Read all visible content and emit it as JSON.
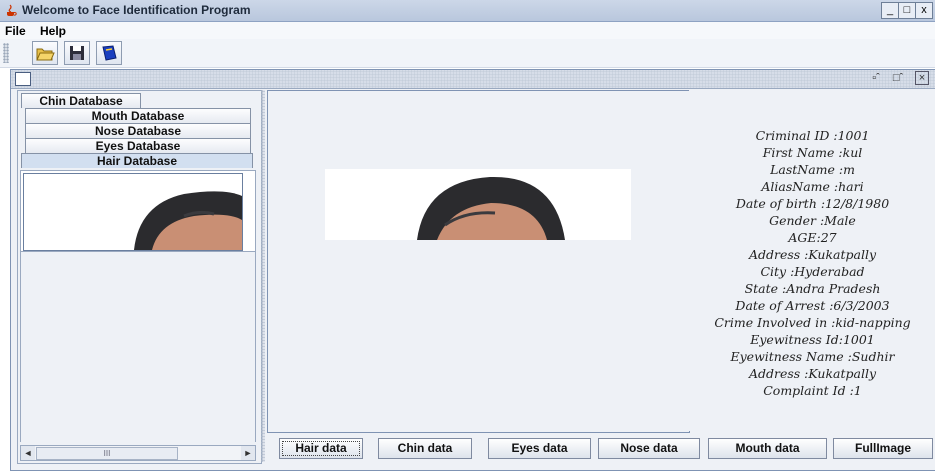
{
  "window": {
    "title": "Welcome to Face Identification Program",
    "minimize": "_",
    "maximize": "□",
    "close": "x"
  },
  "menu": {
    "items": [
      "File",
      "Help"
    ]
  },
  "toolbar": {
    "buttons": [
      "open-folder-icon",
      "save-icon",
      "book-icon"
    ]
  },
  "tabs": [
    "Chin Database",
    "Mouth Database",
    "Nose Database",
    "Eyes Database",
    "Hair Database"
  ],
  "active_tab": "Hair Database",
  "scrollbar": {
    "left": "◄",
    "right": "►",
    "grip": "III"
  },
  "details": [
    "Criminal ID :1001",
    "First Name :kul",
    "LastName :m",
    "AliasName :hari",
    "Date of birth :12/8/1980",
    "Gender :Male",
    "AGE:27",
    "Address :Kukatpally",
    "City :Hyderabad",
    "State :Andra Pradesh",
    "Date of Arrest :6/3/2003",
    "Crime Involved in :kid-napping",
    "Eyewitness Id:1001",
    "Eyewitness Name :Sudhir",
    "Address :Kukatpally",
    "Complaint Id :1"
  ],
  "buttons": [
    "Hair data",
    "Chin data",
    "Eyes data",
    "Nose data",
    "Mouth data",
    "FullImage"
  ],
  "colors": {
    "hair": "#2b2b2e",
    "skin": "#c98f74",
    "frame": "#7f93b3"
  }
}
